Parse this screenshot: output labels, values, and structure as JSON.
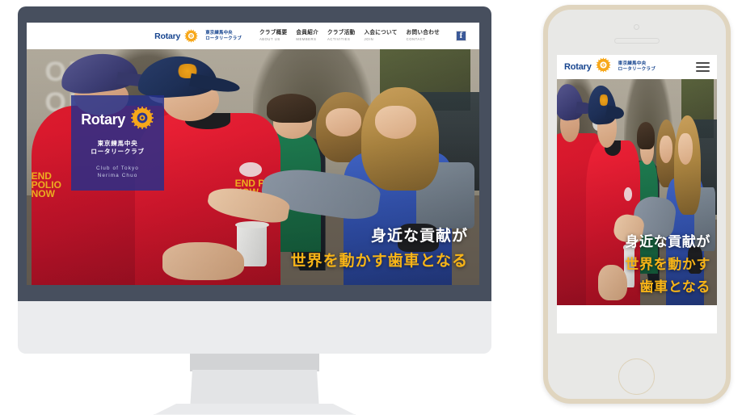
{
  "brand": {
    "wordmark": "Rotary",
    "wheel_icon": "rotary-wheel-icon",
    "jp_line1": "東京練馬中央",
    "jp_line2": "ロータリークラブ"
  },
  "desktop": {
    "nav_items": [
      {
        "jp": "クラブ概要",
        "en": "ABOUT US"
      },
      {
        "jp": "会員紹介",
        "en": "MEMBERS"
      },
      {
        "jp": "クラブ活動",
        "en": "ACTIVITIES"
      },
      {
        "jp": "入会について",
        "en": "JOIN"
      },
      {
        "jp": "お問い合わせ",
        "en": "CONTACT"
      }
    ],
    "facebook_icon": "facebook-icon",
    "facebook_glyph": "f",
    "hero": {
      "line1": "身近な貢献が",
      "line2": "世界を動かす歯車となる",
      "card": {
        "wordmark": "Rotary",
        "jp_line1": "東京練馬中央",
        "jp_line2": "ロータリークラブ",
        "en_line1": "Club of Tokyo",
        "en_line2": "Nerima Chuo"
      },
      "photo_text": {
        "sign1": "OPT",
        "sign2": "ORT",
        "shirt_left": "END POLIO NOW",
        "shirt_right": "END POLIO NOW"
      }
    }
  },
  "mobile": {
    "menu_icon": "hamburger-menu-icon",
    "hero": {
      "line1": "身近な貢献が",
      "line2": "世界を動かす",
      "line3": "歯車となる"
    }
  },
  "colors": {
    "rotary_blue": "#17458f",
    "rotary_gold": "#f7b417",
    "card_overlay": "#232f8c",
    "monitor_bezel": "#474f5e",
    "phone_gold": "#e0d5bf",
    "facebook_blue": "#3b5998"
  }
}
